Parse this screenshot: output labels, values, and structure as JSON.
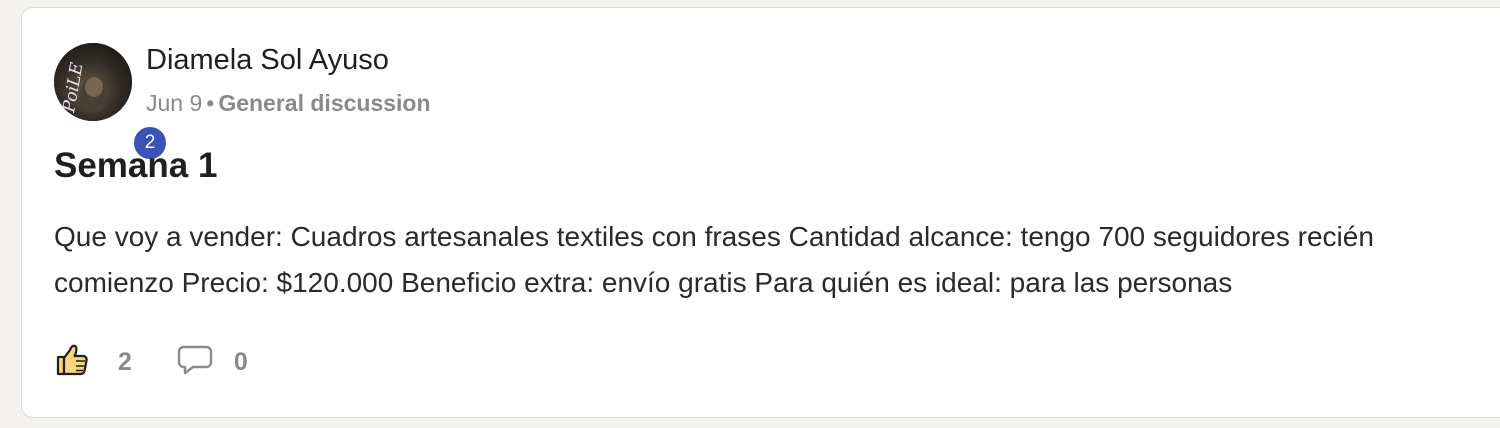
{
  "post": {
    "author": {
      "name": "Diamela Sol Ayuso",
      "level": "2",
      "avatar_text": "PoiLE"
    },
    "date": "Jun 9",
    "separator": "•",
    "category": "General discussion",
    "title": "Semana 1",
    "body": "Que voy a vender: Cuadros artesanales textiles con frases Cantidad alcance: tengo 700 seguidores recién comienzo Precio: $120.000 Beneficio extra: envío gratis Para quién es ideal: para las personas",
    "likes": "2",
    "comments": "0"
  },
  "colors": {
    "badge": "#3b53b8",
    "like_icon_fill": "#f7d77a",
    "muted_text": "#8a8a8a"
  },
  "icons": {
    "like": "thumbs-up-icon",
    "comment": "speech-bubble-icon"
  }
}
